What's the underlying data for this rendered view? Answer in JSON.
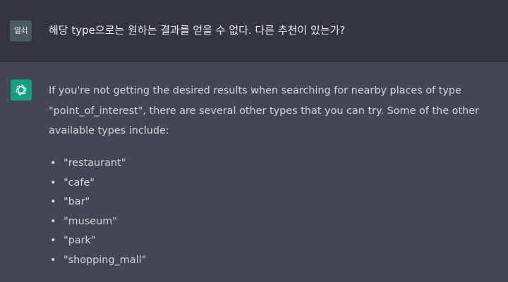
{
  "user_message": {
    "avatar_label": "열쇠",
    "text": "해당 type으로는 원하는 결과를 얻을 수 없다. 다른 추천이 있는가?"
  },
  "assistant_message": {
    "avatar_icon": "openai-logo-icon",
    "paragraph": "If you're not getting the desired results when searching for nearby places of type \"point_of_interest\", there are several other types that you can try. Some of the other available types include:",
    "bullet_char": "•",
    "types": [
      "\"restaurant\"",
      "\"cafe\"",
      "\"bar\"",
      "\"museum\"",
      "\"park\"",
      "\"shopping_mall\""
    ]
  },
  "colors": {
    "user_bg": "#343541",
    "assistant_bg": "#444654",
    "assistant_avatar": "#10a37f",
    "text": "#d1d5db"
  }
}
